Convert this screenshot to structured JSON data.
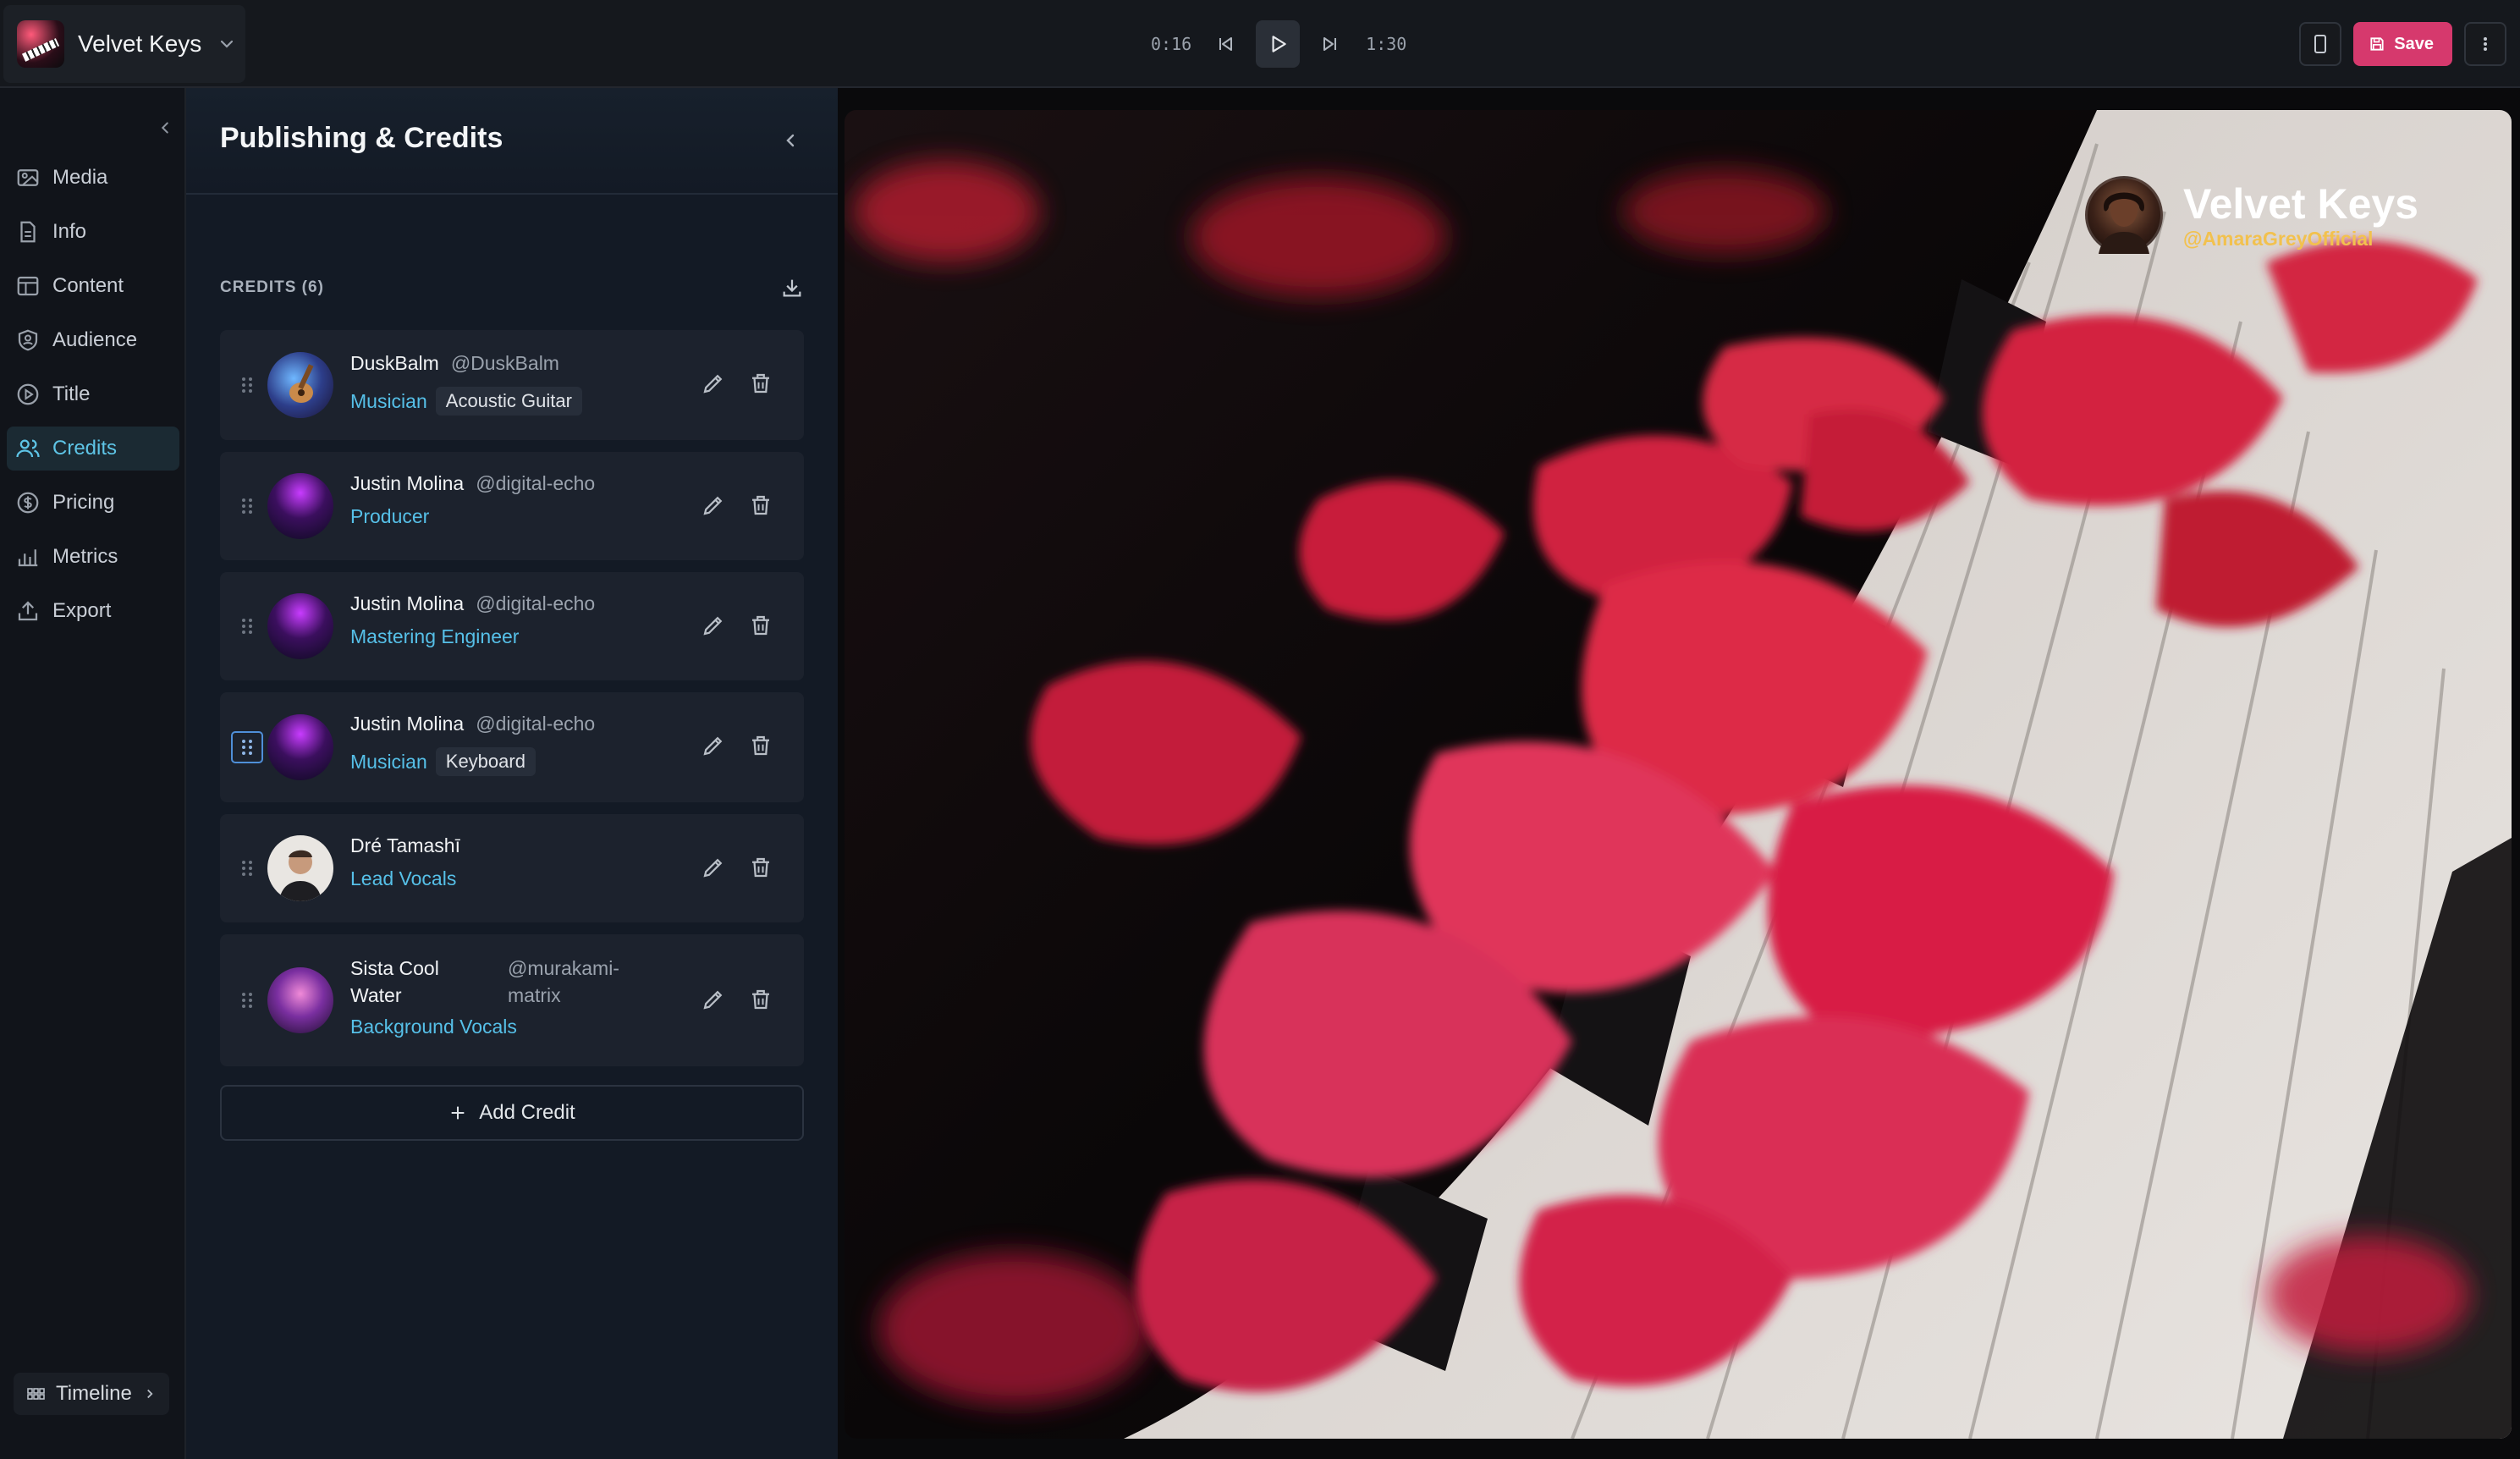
{
  "header": {
    "project_name": "Velvet Keys",
    "time_current": "0:16",
    "time_total": "1:30",
    "save_label": "Save"
  },
  "nav": {
    "items": [
      {
        "label": "Media",
        "icon": "media-icon"
      },
      {
        "label": "Info",
        "icon": "document-icon"
      },
      {
        "label": "Content",
        "icon": "table-icon"
      },
      {
        "label": "Audience",
        "icon": "shield-user-icon"
      },
      {
        "label": "Title",
        "icon": "play-circle-icon"
      },
      {
        "label": "Credits",
        "icon": "users-icon",
        "active": true
      },
      {
        "label": "Pricing",
        "icon": "dollar-circle-icon"
      },
      {
        "label": "Metrics",
        "icon": "bar-chart-icon"
      },
      {
        "label": "Export",
        "icon": "upload-icon"
      }
    ],
    "timeline_label": "Timeline"
  },
  "panel": {
    "title": "Publishing & Credits",
    "section_label": "CREDITS (6)",
    "add_label": "Add Credit",
    "credits": [
      {
        "name": "DuskBalm",
        "handle": "@DuskBalm",
        "role": "Musician",
        "instrument": "Acoustic Guitar"
      },
      {
        "name": "Justin Molina",
        "handle": "@digital-echo",
        "role": "Producer"
      },
      {
        "name": "Justin Molina",
        "handle": "@digital-echo",
        "role": "Mastering Engineer"
      },
      {
        "name": "Justin Molina",
        "handle": "@digital-echo",
        "role": "Musician",
        "instrument": "Keyboard"
      },
      {
        "name": "Dré Tamashī",
        "handle": "",
        "role": "Lead Vocals"
      },
      {
        "name_line1": "Sista Cool",
        "name_line2": "Water",
        "handle_line1": "@murakami-",
        "handle_line2": "matrix",
        "role": "Background Vocals"
      }
    ]
  },
  "preview": {
    "title": "Velvet Keys",
    "handle": "@AmaraGreyOfficial"
  },
  "colors": {
    "accent": "#56c0e8",
    "save": "#d6396d",
    "handle_yellow": "#f2c14e"
  }
}
